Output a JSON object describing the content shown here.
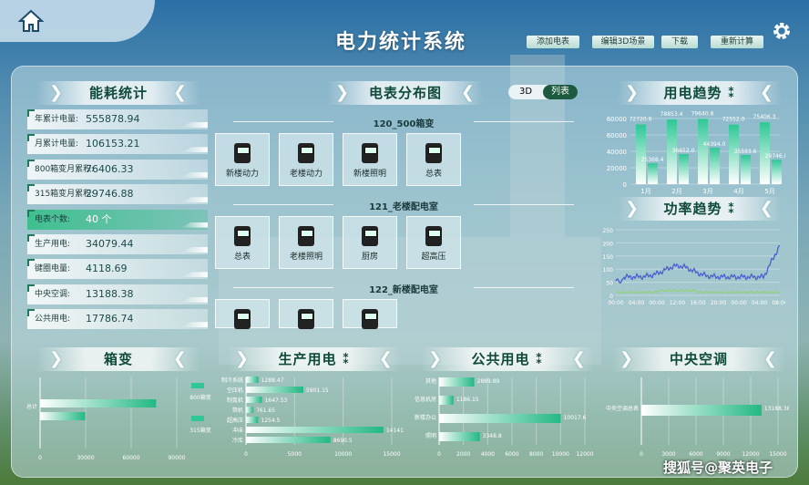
{
  "header": {
    "title": "电力统计系统",
    "buttons": [
      "添加电表",
      "编辑3D场景",
      "下载",
      "重新计算"
    ]
  },
  "energy": {
    "title": "能耗统计",
    "items": [
      {
        "label": "年累计电量:",
        "value": "555878.94"
      },
      {
        "label": "月累计电量:",
        "value": "106153.21"
      },
      {
        "label": "800箱变月累积:",
        "value": "76406.33"
      },
      {
        "label": "315箱变月累积:",
        "value": "29746.88"
      },
      {
        "label": "电表个数:",
        "value": "40 个"
      },
      {
        "label": "生产用电:",
        "value": "34079.44"
      },
      {
        "label": "键圈电量:",
        "value": "4118.69"
      },
      {
        "label": "中央空调:",
        "value": "13188.38"
      },
      {
        "label": "公共用电:",
        "value": "17786.74"
      }
    ]
  },
  "meters": {
    "title": "电表分布图",
    "toggle": [
      "3D",
      "列表"
    ],
    "groups": [
      {
        "name": "120_500箱变",
        "items": [
          "新楼动力",
          "老楼动力",
          "新楼照明",
          "总表"
        ]
      },
      {
        "name": "121_老楼配电室",
        "items": [
          "总表",
          "老楼照明",
          "厨房",
          "超高压"
        ]
      },
      {
        "name": "122_新楼配电室",
        "items": [
          "",
          "",
          ""
        ]
      }
    ]
  },
  "trend": {
    "title": "用电趋势"
  },
  "power": {
    "title": "功率趋势"
  },
  "transformer": {
    "title": "箱变"
  },
  "production": {
    "title": "生产用电"
  },
  "public": {
    "title": "公共用电"
  },
  "ac": {
    "title": "中央空调"
  },
  "watermark": "搜狐号@聚英电子",
  "chart_data": [
    {
      "type": "bar",
      "title": "用电趋势",
      "categories": [
        "1月",
        "2月",
        "3月",
        "4月",
        "5月"
      ],
      "series": [
        {
          "values": [
            72720.6,
            78853.4,
            79640.8,
            72552.0,
            75406.3
          ]
        },
        {
          "values": [
            25368.4,
            36652.0,
            44394.0,
            35593.6,
            29746.8
          ]
        }
      ],
      "labels": [
        [
          "72720.6",
          "25368.4"
        ],
        [
          "78853.4",
          "36652.0"
        ],
        [
          "79640.8",
          "44394.0"
        ],
        [
          "72552.0",
          "35593.6"
        ],
        [
          "75406.3",
          "29746.8"
        ]
      ],
      "ylim": [
        0,
        80000
      ],
      "yticks": [
        "0",
        "20000",
        "40000",
        "60000",
        "80000"
      ]
    },
    {
      "type": "line",
      "title": "功率趋势",
      "xticks": [
        "00:00",
        "04:00",
        "00:00",
        "12:00",
        "16:00",
        "20:00",
        "00:00",
        "04:00",
        "08:00"
      ],
      "yticks": [
        "0",
        "50",
        "100",
        "150",
        "200",
        "250"
      ],
      "ylim": [
        0,
        250
      ]
    },
    {
      "type": "bar",
      "title": "箱变",
      "categories": [
        "总计"
      ],
      "series": [
        {
          "values": [
            76406.33
          ]
        },
        {
          "values": [
            29746.88
          ]
        }
      ],
      "legend": [
        "800箱变",
        "315箱变"
      ],
      "xticks": [
        "0",
        "30000",
        "60000",
        "90000"
      ],
      "xlim": [
        0,
        90000
      ]
    },
    {
      "type": "bar",
      "title": "生产用电",
      "categories": [
        "制冷系统",
        "空压机",
        "制氮机",
        "筛机",
        "超高压",
        "冲床",
        "冷库"
      ],
      "values": [
        1288.47,
        5901.15,
        1647.53,
        761.65,
        1254.5,
        14141,
        8690.5
      ],
      "labels": [
        "1288.47",
        "5901.15",
        "1647.53",
        "761.65",
        "1254.5",
        "14141",
        "8690.5"
      ],
      "xticks": [
        "0",
        "5000",
        "10000",
        "15000"
      ],
      "xlim": [
        0,
        15000
      ]
    },
    {
      "type": "bar",
      "title": "公共用电",
      "categories": [
        "其他",
        "信息机房",
        "新楼办公",
        "照明"
      ],
      "values": [
        2889.89,
        1186.15,
        10017.6,
        3348.8
      ],
      "labels": [
        "2889.89",
        "1186.15",
        "10017.6",
        "3348.8"
      ],
      "xticks": [
        "0",
        "2000",
        "4000",
        "6000",
        "8000",
        "10000",
        "12000"
      ],
      "xlim": [
        0,
        12000
      ]
    },
    {
      "type": "bar",
      "title": "中央空调",
      "categories": [
        "中央空调总表"
      ],
      "values": [
        13188.38
      ],
      "labels": [
        "13188.38"
      ],
      "xticks": [
        "0",
        "3000",
        "6000",
        "9000",
        "12000",
        "15000"
      ],
      "xlim": [
        0,
        15000
      ]
    }
  ]
}
